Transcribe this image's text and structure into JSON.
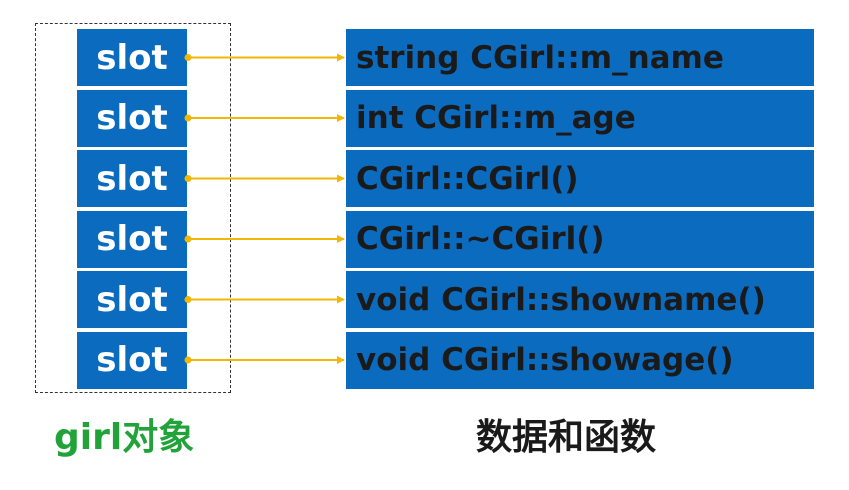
{
  "colors": {
    "box": "#0a6bbf",
    "arrow": "#f2b705",
    "caption_green": "#22a33a",
    "text_dark": "#1a1a1a"
  },
  "slots": [
    "slot",
    "slot",
    "slot",
    "slot",
    "slot",
    "slot"
  ],
  "members": [
    "string CGirl::m_name",
    "int CGirl::m_age",
    "CGirl::CGirl()",
    "CGirl::~CGirl()",
    "void CGirl::showname()",
    "void CGirl::showage()"
  ],
  "captions": {
    "object": "girl对象",
    "data_and_functions": "数据和函数"
  }
}
